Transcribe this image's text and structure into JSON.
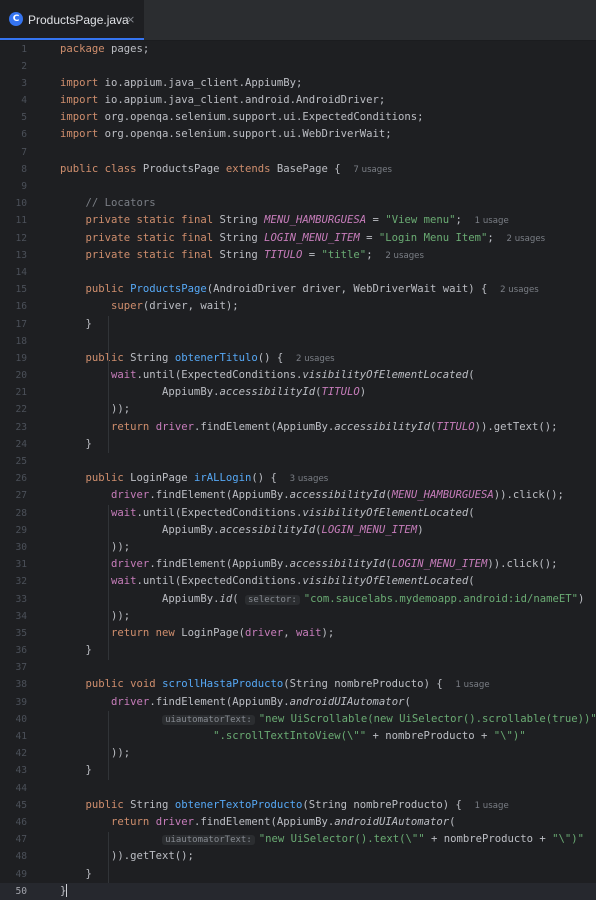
{
  "tab": {
    "title": "ProductsPage.java",
    "icon": "C",
    "close": "×"
  },
  "lines": [
    {
      "n": "1",
      "t": [
        [
          "kw",
          "package"
        ],
        [
          "",
          "pages;"
        ]
      ]
    },
    {
      "n": "2",
      "t": []
    },
    {
      "n": "3",
      "t": [
        [
          "kw",
          "import"
        ],
        [
          "",
          "io.appium.java_client.AppiumBy;"
        ]
      ]
    },
    {
      "n": "4",
      "t": [
        [
          "kw",
          "import"
        ],
        [
          "",
          "io.appium.java_client.android.AndroidDriver;"
        ]
      ]
    },
    {
      "n": "5",
      "t": [
        [
          "kw",
          "import"
        ],
        [
          "",
          "org.openqa.selenium.support.ui.ExpectedConditions;"
        ]
      ]
    },
    {
      "n": "6",
      "t": [
        [
          "kw",
          "import"
        ],
        [
          "",
          "org.openqa.selenium.support.ui.WebDriverWait;"
        ]
      ]
    },
    {
      "n": "7",
      "t": []
    },
    {
      "n": "8",
      "t": [
        [
          "kw",
          "public class"
        ],
        [
          "",
          "ProductsPage "
        ],
        [
          "kw",
          "extends"
        ],
        [
          "",
          "BasePage {  "
        ],
        [
          "hint",
          "7 usages"
        ]
      ]
    },
    {
      "n": "9",
      "t": []
    },
    {
      "n": "10",
      "t": [
        [
          "",
          "    "
        ],
        [
          "cm",
          "// Locators"
        ]
      ]
    },
    {
      "n": "11",
      "t": [
        [
          "",
          "    "
        ],
        [
          "kw",
          "private static final"
        ],
        [
          "",
          "String "
        ],
        [
          "fld",
          "MENU_HAMBURGUESA"
        ],
        [
          "",
          " = "
        ],
        [
          "str",
          "\"View menu\""
        ],
        [
          "",
          ";  "
        ],
        [
          "hint",
          "1 usage"
        ]
      ]
    },
    {
      "n": "12",
      "t": [
        [
          "",
          "    "
        ],
        [
          "kw",
          "private static final"
        ],
        [
          "",
          "String "
        ],
        [
          "fld",
          "LOGIN_MENU_ITEM"
        ],
        [
          "",
          " = "
        ],
        [
          "str",
          "\"Login Menu Item\""
        ],
        [
          "",
          ";  "
        ],
        [
          "hint",
          "2 usages"
        ]
      ]
    },
    {
      "n": "13",
      "t": [
        [
          "",
          "    "
        ],
        [
          "kw",
          "private static final"
        ],
        [
          "",
          "String "
        ],
        [
          "fld",
          "TITULO"
        ],
        [
          "",
          " = "
        ],
        [
          "str",
          "\"title\""
        ],
        [
          "",
          ";  "
        ],
        [
          "hint",
          "2 usages"
        ]
      ]
    },
    {
      "n": "14",
      "t": []
    },
    {
      "n": "15",
      "t": [
        [
          "",
          "    "
        ],
        [
          "kw",
          "public"
        ],
        [
          "mdecl",
          "ProductsPage"
        ],
        [
          "",
          "(AndroidDriver driver, WebDriverWait wait) {  "
        ],
        [
          "hint",
          "2 usages"
        ]
      ]
    },
    {
      "n": "16",
      "t": [
        [
          "",
          "        "
        ],
        [
          "kw",
          "super"
        ],
        [
          "",
          "(driver, wait);"
        ]
      ]
    },
    {
      "n": "17",
      "t": [
        [
          "",
          "    }"
        ]
      ]
    },
    {
      "n": "18",
      "t": []
    },
    {
      "n": "19",
      "t": [
        [
          "",
          "    "
        ],
        [
          "kw",
          "public"
        ],
        [
          "",
          "String "
        ],
        [
          "mdecl",
          "obtenerTitulo"
        ],
        [
          "",
          "() {  "
        ],
        [
          "hint",
          "2 usages"
        ]
      ]
    },
    {
      "n": "20",
      "t": [
        [
          "",
          "        "
        ],
        [
          "fld2",
          "wait"
        ],
        [
          "",
          ".until(ExpectedConditions."
        ],
        [
          "itl",
          "visibilityOfElementLocated"
        ],
        [
          "",
          "("
        ]
      ]
    },
    {
      "n": "21",
      "t": [
        [
          "",
          "                AppiumBy."
        ],
        [
          "itl",
          "accessibilityId"
        ],
        [
          "",
          "("
        ],
        [
          "fld",
          "TITULO"
        ],
        [
          "",
          ")"
        ]
      ]
    },
    {
      "n": "22",
      "t": [
        [
          "",
          "        ));"
        ]
      ]
    },
    {
      "n": "23",
      "t": [
        [
          "",
          "        "
        ],
        [
          "kw",
          "return"
        ],
        [
          "fld2",
          "driver"
        ],
        [
          "",
          ".findElement(AppiumBy."
        ],
        [
          "itl",
          "accessibilityId"
        ],
        [
          "",
          "("
        ],
        [
          "fld",
          "TITULO"
        ],
        [
          "",
          ")).getText();"
        ]
      ]
    },
    {
      "n": "24",
      "t": [
        [
          "",
          "    }"
        ]
      ]
    },
    {
      "n": "25",
      "t": []
    },
    {
      "n": "26",
      "t": [
        [
          "",
          "    "
        ],
        [
          "kw",
          "public"
        ],
        [
          "",
          "LoginPage "
        ],
        [
          "mdecl",
          "irALLogin"
        ],
        [
          "",
          "() {  "
        ],
        [
          "hint",
          "3 usages"
        ]
      ]
    },
    {
      "n": "27",
      "t": [
        [
          "",
          "        "
        ],
        [
          "fld2",
          "driver"
        ],
        [
          "",
          ".findElement(AppiumBy."
        ],
        [
          "itl",
          "accessibilityId"
        ],
        [
          "",
          "("
        ],
        [
          "fld",
          "MENU_HAMBURGUESA"
        ],
        [
          "",
          ")).click();"
        ]
      ]
    },
    {
      "n": "28",
      "t": [
        [
          "",
          "        "
        ],
        [
          "fld2",
          "wait"
        ],
        [
          "",
          ".until(ExpectedConditions."
        ],
        [
          "itl",
          "visibilityOfElementLocated"
        ],
        [
          "",
          "("
        ]
      ]
    },
    {
      "n": "29",
      "t": [
        [
          "",
          "                AppiumBy."
        ],
        [
          "itl",
          "accessibilityId"
        ],
        [
          "",
          "("
        ],
        [
          "fld",
          "LOGIN_MENU_ITEM"
        ],
        [
          "",
          ")"
        ]
      ]
    },
    {
      "n": "30",
      "t": [
        [
          "",
          "        ));"
        ]
      ]
    },
    {
      "n": "31",
      "t": [
        [
          "",
          "        "
        ],
        [
          "fld2",
          "driver"
        ],
        [
          "",
          ".findElement(AppiumBy."
        ],
        [
          "itl",
          "accessibilityId"
        ],
        [
          "",
          "("
        ],
        [
          "fld",
          "LOGIN_MENU_ITEM"
        ],
        [
          "",
          ")).click();"
        ]
      ]
    },
    {
      "n": "32",
      "t": [
        [
          "",
          "        "
        ],
        [
          "fld2",
          "wait"
        ],
        [
          "",
          ".until(ExpectedConditions."
        ],
        [
          "itl",
          "visibilityOfElementLocated"
        ],
        [
          "",
          "("
        ]
      ]
    },
    {
      "n": "33",
      "t": [
        [
          "",
          "                AppiumBy."
        ],
        [
          "itl",
          "id"
        ],
        [
          "",
          "( "
        ],
        [
          "inlay",
          "selector:"
        ],
        [
          "str",
          "\"com.saucelabs.mydemoapp.android:id/nameET\""
        ],
        [
          "",
          ")"
        ]
      ]
    },
    {
      "n": "34",
      "t": [
        [
          "",
          "        ));"
        ]
      ]
    },
    {
      "n": "35",
      "t": [
        [
          "",
          "        "
        ],
        [
          "kw",
          "return new"
        ],
        [
          "",
          "LoginPage("
        ],
        [
          "fld2",
          "driver"
        ],
        [
          "",
          ", "
        ],
        [
          "fld2",
          "wait"
        ],
        [
          "",
          ");"
        ]
      ]
    },
    {
      "n": "36",
      "t": [
        [
          "",
          "    }"
        ]
      ]
    },
    {
      "n": "37",
      "t": []
    },
    {
      "n": "38",
      "t": [
        [
          "",
          "    "
        ],
        [
          "kw",
          "public void"
        ],
        [
          "mdecl",
          "scrollHastaProducto"
        ],
        [
          "",
          "(String nombreProducto) {  "
        ],
        [
          "hint",
          "1 usage"
        ]
      ]
    },
    {
      "n": "39",
      "t": [
        [
          "",
          "        "
        ],
        [
          "fld2",
          "driver"
        ],
        [
          "",
          ".findElement(AppiumBy."
        ],
        [
          "itl",
          "androidUIAutomator"
        ],
        [
          "",
          "("
        ]
      ]
    },
    {
      "n": "40",
      "t": [
        [
          "",
          "                "
        ],
        [
          "inlay",
          "uiautomatorText:"
        ],
        [
          "str",
          "\"new UiScrollable(new UiSelector().scrollable(true))\""
        ],
        [
          "",
          " +"
        ]
      ]
    },
    {
      "n": "41",
      "t": [
        [
          "",
          "                        "
        ],
        [
          "str",
          "\".scrollTextIntoView(\\\"\""
        ],
        [
          "",
          " + nombreProducto + "
        ],
        [
          "str",
          "\"\\\")\""
        ]
      ]
    },
    {
      "n": "42",
      "t": [
        [
          "",
          "        ));"
        ]
      ]
    },
    {
      "n": "43",
      "t": [
        [
          "",
          "    }"
        ]
      ]
    },
    {
      "n": "44",
      "t": []
    },
    {
      "n": "45",
      "t": [
        [
          "",
          "    "
        ],
        [
          "kw",
          "public"
        ],
        [
          "",
          "String "
        ],
        [
          "mdecl",
          "obtenerTextoProducto"
        ],
        [
          "",
          "(String nombreProducto) {  "
        ],
        [
          "hint",
          "1 usage"
        ]
      ]
    },
    {
      "n": "46",
      "t": [
        [
          "",
          "        "
        ],
        [
          "kw",
          "return"
        ],
        [
          "fld2",
          "driver"
        ],
        [
          "",
          ".findElement(AppiumBy."
        ],
        [
          "itl",
          "androidUIAutomator"
        ],
        [
          "",
          "("
        ]
      ]
    },
    {
      "n": "47",
      "t": [
        [
          "",
          "                "
        ],
        [
          "inlay",
          "uiautomatorText:"
        ],
        [
          "str",
          "\"new UiSelector().text(\\\"\""
        ],
        [
          "",
          " + nombreProducto + "
        ],
        [
          "str",
          "\"\\\")\""
        ]
      ]
    },
    {
      "n": "48",
      "t": [
        [
          "",
          "        )).getText();"
        ]
      ]
    },
    {
      "n": "49",
      "t": [
        [
          "",
          "    }"
        ]
      ]
    },
    {
      "n": "50",
      "t": [
        [
          "",
          "}"
        ]
      ],
      "current": true
    }
  ]
}
